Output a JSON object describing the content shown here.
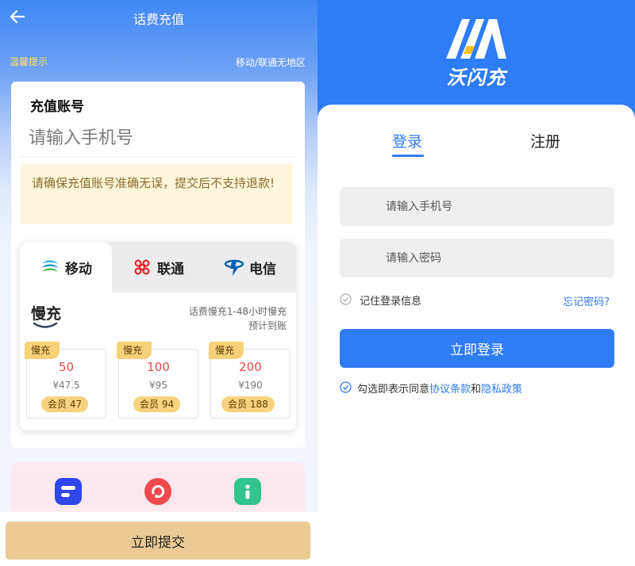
{
  "left": {
    "header": {
      "title": "话费充值"
    },
    "tips": {
      "label": "温馨提示",
      "note": "移动/联通无地区"
    },
    "account": {
      "label": "充值账号",
      "placeholder": "请输入手机号",
      "warning": "请确保充值账号准确无误，提交后不支持退款!"
    },
    "carriers": [
      {
        "label": "移动",
        "icon": "china-mobile-icon",
        "active": true
      },
      {
        "label": "联通",
        "icon": "china-unicom-icon",
        "active": false
      },
      {
        "label": "电信",
        "icon": "china-telecom-icon",
        "active": false
      }
    ],
    "speed": {
      "logo": "慢充",
      "desc_line1": "话费慢充1-48小时慢充",
      "desc_line2": "预计到账"
    },
    "packages": [
      {
        "tag": "慢充",
        "face": "50",
        "price": "¥47.5",
        "member": "会员 47"
      },
      {
        "tag": "慢充",
        "face": "100",
        "price": "¥95",
        "member": "会员 94"
      },
      {
        "tag": "慢充",
        "face": "200",
        "price": "¥190",
        "member": "会员 188"
      }
    ],
    "promo_icons": [
      "blue-app-icon",
      "red-refresh-icon",
      "green-info-icon"
    ],
    "submit_label": "立即提交"
  },
  "right": {
    "logo_text": "沃闪充",
    "tabs": {
      "login": "登录",
      "register": "注册"
    },
    "phone_placeholder": "请输入手机号",
    "password_placeholder": "请输入密码",
    "remember_label": "记住登录信息",
    "forgot_label": "忘记密码?",
    "login_button": "立即登录",
    "agree": {
      "prefix": "勾选即表示同意",
      "terms": "协议条款",
      "and": "和",
      "privacy": "隐私政策"
    }
  },
  "colors": {
    "primary_blue": "#2e7cf6",
    "gold": "#ebca94",
    "tag_gold": "#f7d177",
    "price_red": "#e94b4b"
  }
}
